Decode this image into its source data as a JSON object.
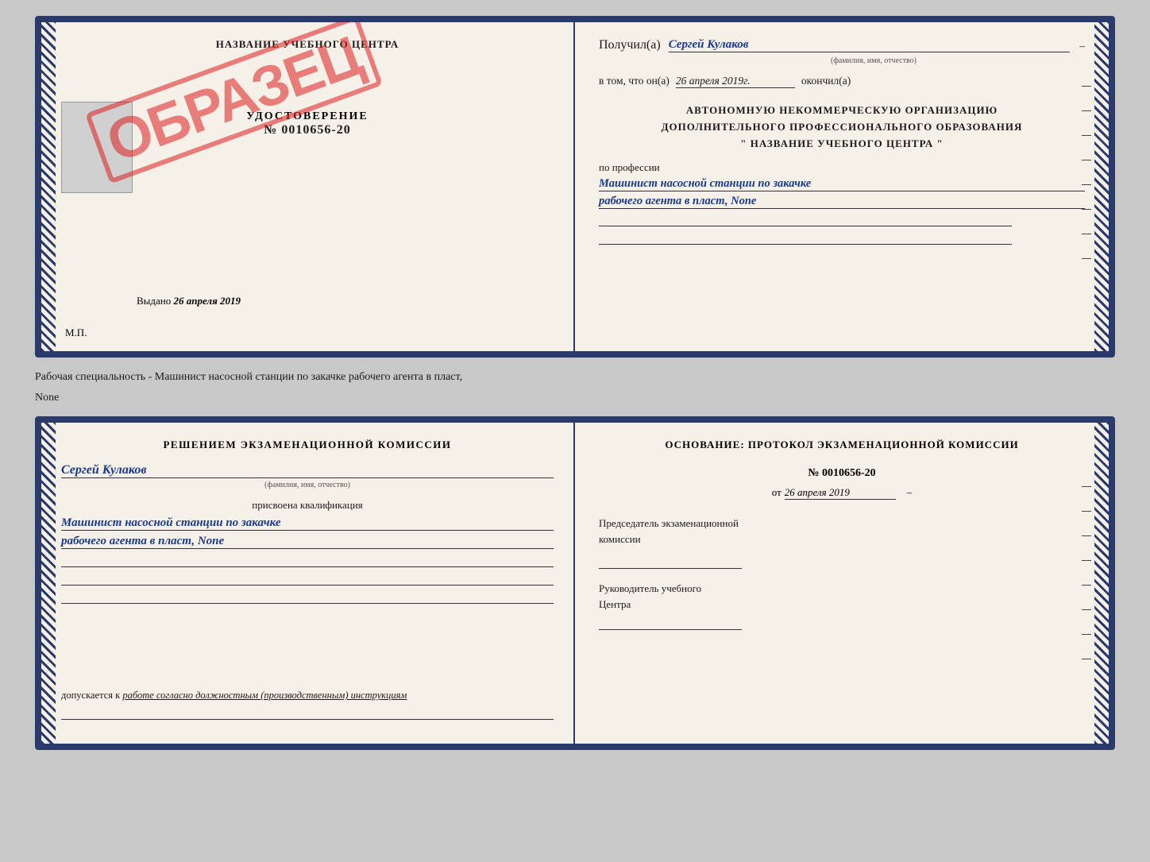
{
  "colors": {
    "border": "#2a3a6b",
    "bg": "#f5f0e8",
    "stamp_red": "rgba(220,30,30,0.55)",
    "blue_text": "#1a3a8a"
  },
  "top_document": {
    "left": {
      "title": "НАЗВАНИЕ УЧЕБНОГО ЦЕНТРА",
      "stamp": "ОБРАЗЕЦ",
      "cert_label": "УДОСТОВЕРЕНИЕ",
      "cert_number": "№ 0010656-20",
      "issued_label": "Выдано",
      "issued_date": "26 апреля 2019",
      "mp_label": "М.П."
    },
    "right": {
      "received_label": "Получил(а)",
      "received_name": "Сергей Кулаков",
      "fio_sub": "(фамилия, имя, отчество)",
      "date_label": "в том, что он(а)",
      "date_value": "26 апреля 2019г.",
      "finished_label": "окончил(а)",
      "org_line1": "АВТОНОМНУЮ НЕКОММЕРЧЕСКУЮ ОРГАНИЗАЦИЮ",
      "org_line2": "ДОПОЛНИТЕЛЬНОГО ПРОФЕССИОНАЛЬНОГО ОБРАЗОВАНИЯ",
      "org_line3": "\"  НАЗВАНИЕ УЧЕБНОГО ЦЕНТРА  \"",
      "profession_label": "по профессии",
      "profession_line1": "Машинист насосной станции по закачке",
      "profession_line2": "рабочего агента в пласт, None"
    }
  },
  "caption": "Рабочая специальность - Машинист насосной станции по закачке рабочего агента в пласт,",
  "caption2": "None",
  "bottom_document": {
    "left": {
      "decision": "Решением экзаменационной комиссии",
      "person_name": "Сергей Кулаков",
      "fio_sub": "(фамилия, имя, отчество)",
      "assigned_label": "присвоена квалификация",
      "profession_line1": "Машинист насосной станции по закачке",
      "profession_line2": "рабочего агента в пласт, None",
      "admission_label": "допускается к",
      "admission_value": "работе согласно должностным (производственным) инструкциям"
    },
    "right": {
      "basis_label": "Основание: протокол экзаменационной комиссии",
      "protocol_num": "№ 0010656-20",
      "date_prefix": "от",
      "date_value": "26 апреля 2019",
      "chairman_label": "Председатель экзаменационной",
      "chairman_label2": "комиссии",
      "head_label": "Руководитель учебного",
      "head_label2": "Центра"
    }
  }
}
